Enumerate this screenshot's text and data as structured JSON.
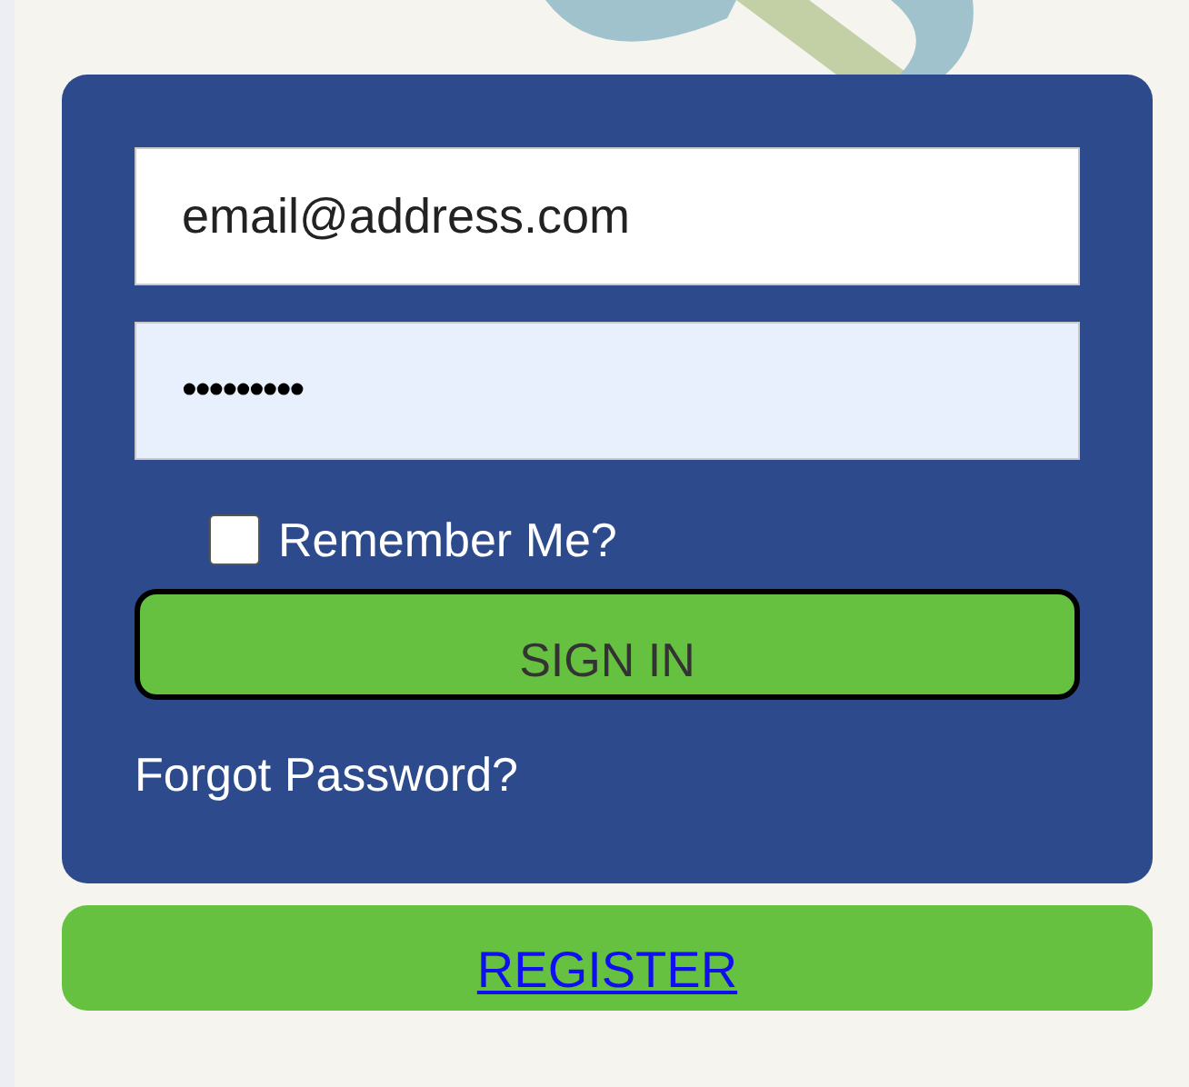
{
  "email_field": {
    "value": "email@address.com"
  },
  "password_field": {
    "value": "•••••••••"
  },
  "remember": {
    "label": "Remember Me?",
    "checked": false
  },
  "sign_in_button": "SIGN IN",
  "forgot_link": "Forgot Password?",
  "register_link": "REGISTER"
}
